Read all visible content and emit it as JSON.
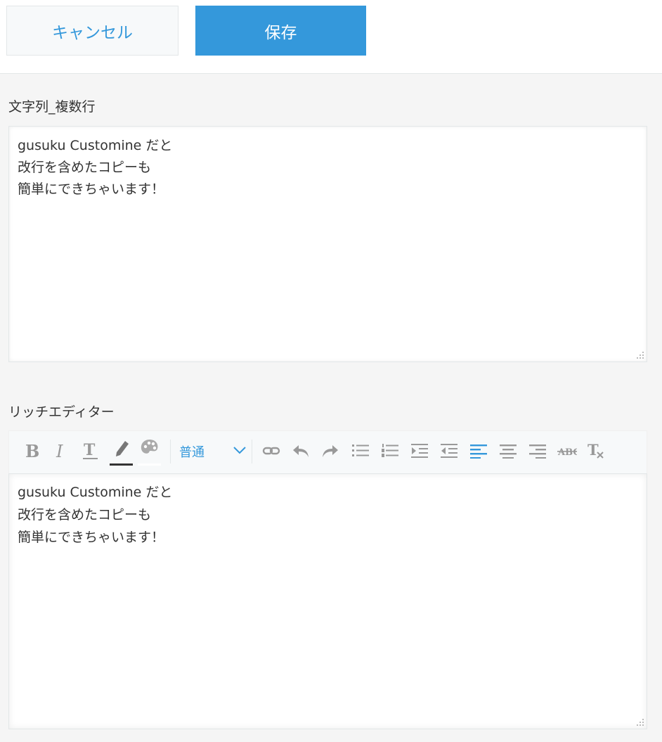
{
  "toolbar": {
    "cancel_label": "キャンセル",
    "save_label": "保存"
  },
  "fields": {
    "multiline": {
      "label": "文字列_複数行",
      "lines": [
        "gusuku Customine だと",
        "改行を含めたコピーも",
        "簡単にできちゃいます！"
      ]
    },
    "rich": {
      "label": "リッチエディター",
      "format_value": "普通",
      "lines": [
        "gusuku Customine だと",
        "改行を含めたコピーも",
        "簡単にできちゃいます！"
      ],
      "tools": [
        "bold-icon",
        "italic-icon",
        "underline-icon",
        "text-color-icon",
        "background-color-icon",
        "link-icon",
        "undo-icon",
        "redo-icon",
        "bulleted-list-icon",
        "numbered-list-icon",
        "indent-icon",
        "outdent-icon",
        "align-left-icon",
        "align-center-icon",
        "align-right-icon",
        "strikethrough-icon",
        "clear-format-icon"
      ]
    }
  },
  "colors": {
    "accent": "#3498db",
    "icon_gray": "#999999",
    "background": "#f5f5f5"
  }
}
